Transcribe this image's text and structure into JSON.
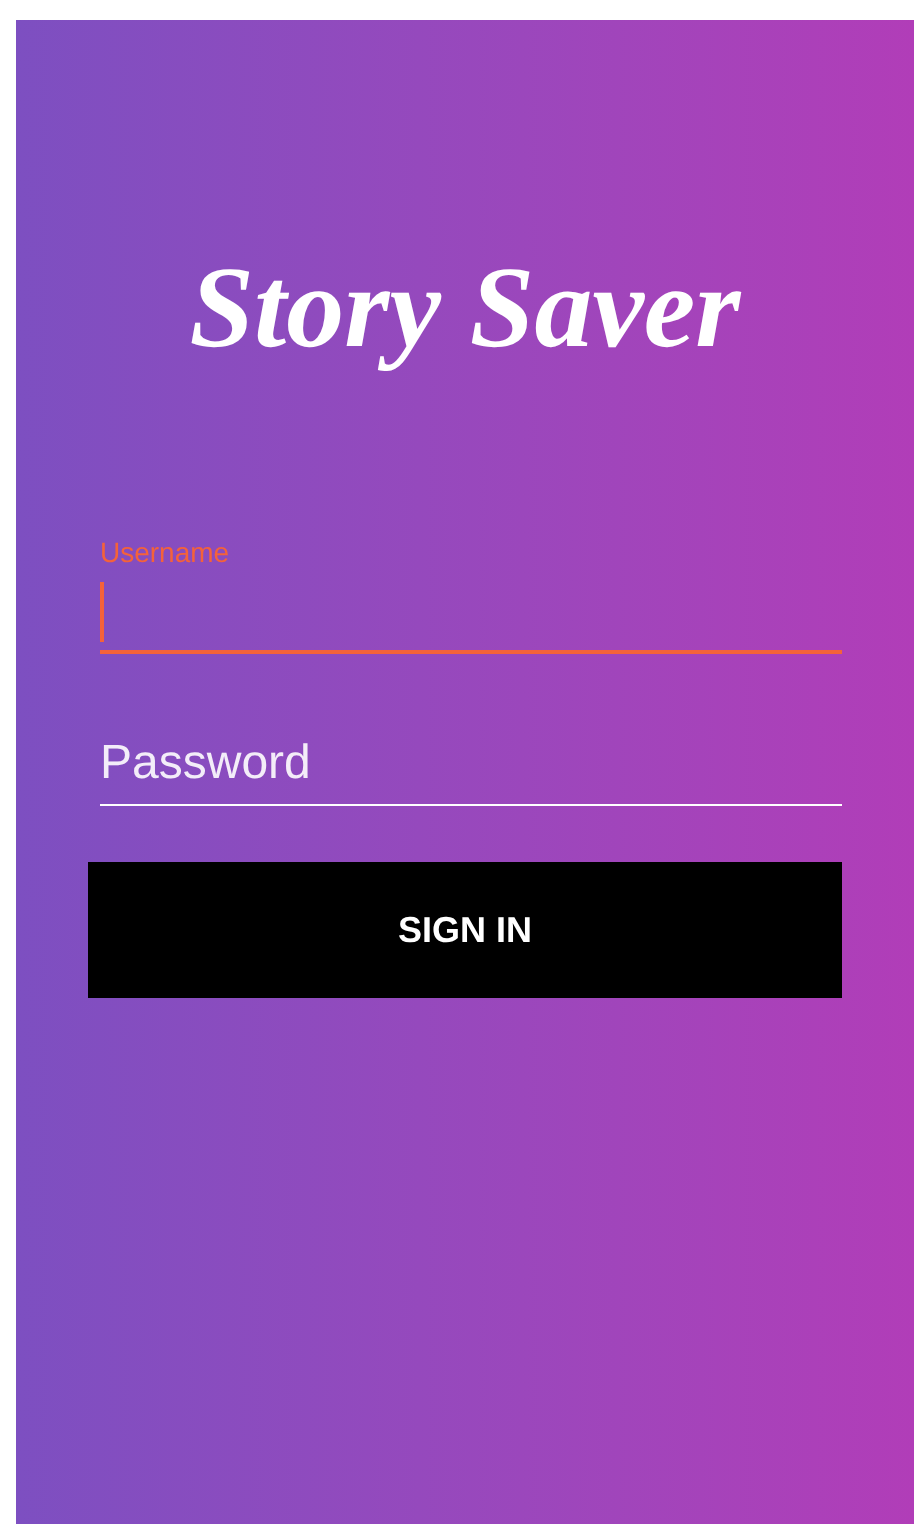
{
  "app": {
    "title": "Story Saver"
  },
  "fields": [
    {
      "label": "Username",
      "focused": true
    },
    {
      "placeholder": "Password",
      "focused": false
    }
  ],
  "button": {
    "label": "SIGN IN"
  }
}
